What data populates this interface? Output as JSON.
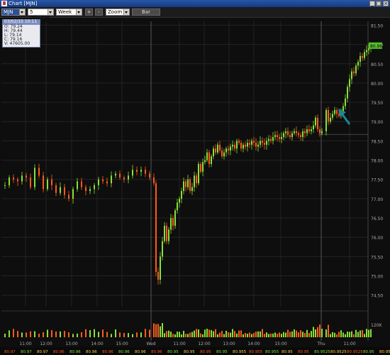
{
  "window": {
    "title": "Chart [MJN]",
    "buttons": [
      "_",
      "□",
      "×"
    ]
  },
  "toolbar": {
    "symbol": "MJN",
    "interval": "5 minutes",
    "range": "Week",
    "plus_label": "+",
    "minus_label": "-",
    "zoom": "Zoom",
    "bar_label": "Bar"
  },
  "ohlc_box": {
    "header": "03/02/15 10:11",
    "open": "O: 79.24",
    "high": "H: 79.44",
    "low": "L: 79.14",
    "close": "C: 79.16",
    "volume": "V: 47605.00"
  },
  "colors": {
    "up": "#88e038",
    "down": "#ff5a1e",
    "grid": "#232323",
    "arrow": "#1a8a96",
    "last_price_bg": "#58c02a"
  },
  "last_price": "80.96",
  "volume_axis_label": "120K",
  "footer_values": [
    "80.97",
    "80.97",
    "80.97",
    "80.96",
    "80.96",
    "80.96",
    "80.96",
    "80.96",
    "80.96",
    "80.96",
    "80.95",
    "80.95",
    "80.95",
    "80.95",
    "80.955",
    "80.955",
    "80.955",
    "80.95",
    "80.95",
    "80.9525",
    "80.9525",
    "80.9525",
    "80.95",
    "80.95"
  ],
  "chart_data": {
    "type": "candlestick",
    "y_ticks": [
      "81.50",
      "81.00",
      "80.50",
      "80.00",
      "79.50",
      "79.00",
      "78.50",
      "78.00",
      "77.50",
      "77.00",
      "76.50",
      "76.00",
      "75.50",
      "75.00",
      "74.50"
    ],
    "ylim": [
      74.2,
      81.6
    ],
    "x_ticks": [
      "11:00",
      "12:00",
      "13:00",
      "14:00",
      "15:00",
      "Wed",
      "11:00",
      "12:00",
      "13:00",
      "14:00",
      "15:00",
      "Thu",
      "11:00"
    ],
    "session_dividers_at": [
      "Wed",
      "Thu"
    ],
    "ohlc_close_path": [
      [
        0,
        77.35
      ],
      [
        6,
        77.55
      ],
      [
        12,
        77.5
      ],
      [
        18,
        77.45
      ],
      [
        24,
        77.6
      ],
      [
        30,
        77.55
      ],
      [
        36,
        77.3
      ],
      [
        42,
        77.8
      ],
      [
        48,
        77.6
      ],
      [
        54,
        77.25
      ],
      [
        60,
        77.5
      ],
      [
        66,
        77.35
      ],
      [
        72,
        77.15
      ],
      [
        78,
        77.3
      ],
      [
        84,
        77.1
      ],
      [
        90,
        77.0
      ],
      [
        96,
        77.25
      ],
      [
        102,
        77.45
      ],
      [
        108,
        77.3
      ],
      [
        114,
        77.2
      ],
      [
        120,
        77.25
      ],
      [
        126,
        77.35
      ],
      [
        132,
        77.5
      ],
      [
        138,
        77.45
      ],
      [
        144,
        77.4
      ],
      [
        150,
        77.6
      ],
      [
        156,
        77.65
      ],
      [
        162,
        77.55
      ],
      [
        168,
        77.5
      ],
      [
        174,
        77.6
      ],
      [
        180,
        77.75
      ],
      [
        186,
        77.7
      ],
      [
        192,
        77.75
      ],
      [
        198,
        77.65
      ],
      [
        204,
        77.55
      ],
      [
        210,
        77.4
      ],
      [
        213,
        75.1
      ],
      [
        216,
        74.9
      ],
      [
        219,
        75.5
      ],
      [
        222,
        75.9
      ],
      [
        225,
        76.3
      ],
      [
        228,
        75.9
      ],
      [
        231,
        76.2
      ],
      [
        234,
        76.5
      ],
      [
        237,
        76.3
      ],
      [
        240,
        76.7
      ],
      [
        243,
        76.9
      ],
      [
        246,
        77.0
      ],
      [
        249,
        77.2
      ],
      [
        252,
        77.45
      ],
      [
        255,
        77.3
      ],
      [
        258,
        77.5
      ],
      [
        261,
        77.2
      ],
      [
        264,
        77.3
      ],
      [
        267,
        77.6
      ],
      [
        270,
        77.4
      ],
      [
        273,
        77.9
      ],
      [
        276,
        77.7
      ],
      [
        279,
        77.95
      ],
      [
        282,
        78.0
      ],
      [
        285,
        78.2
      ],
      [
        288,
        77.9
      ],
      [
        291,
        78.1
      ],
      [
        294,
        78.3
      ],
      [
        297,
        78.2
      ],
      [
        300,
        78.4
      ],
      [
        303,
        78.25
      ],
      [
        306,
        78.1
      ],
      [
        309,
        78.2
      ],
      [
        312,
        78.3
      ],
      [
        315,
        78.25
      ],
      [
        318,
        78.35
      ],
      [
        321,
        78.4
      ],
      [
        324,
        78.3
      ],
      [
        327,
        78.5
      ],
      [
        330,
        78.45
      ],
      [
        333,
        78.3
      ],
      [
        336,
        78.4
      ],
      [
        339,
        78.35
      ],
      [
        342,
        78.45
      ],
      [
        345,
        78.4
      ],
      [
        348,
        78.5
      ],
      [
        351,
        78.45
      ],
      [
        354,
        78.35
      ],
      [
        357,
        78.4
      ],
      [
        360,
        78.5
      ],
      [
        363,
        78.45
      ],
      [
        366,
        78.4
      ],
      [
        369,
        78.5
      ],
      [
        372,
        78.55
      ],
      [
        375,
        78.5
      ],
      [
        378,
        78.6
      ],
      [
        381,
        78.65
      ],
      [
        384,
        78.6
      ],
      [
        387,
        78.55
      ],
      [
        390,
        78.6
      ],
      [
        393,
        78.7
      ],
      [
        396,
        78.75
      ],
      [
        399,
        78.65
      ],
      [
        402,
        78.6
      ],
      [
        405,
        78.7
      ],
      [
        408,
        78.75
      ],
      [
        411,
        78.7
      ],
      [
        414,
        78.65
      ],
      [
        417,
        78.6
      ],
      [
        420,
        78.75
      ],
      [
        423,
        78.7
      ],
      [
        426,
        78.8
      ],
      [
        429,
        78.75
      ],
      [
        432,
        78.8
      ],
      [
        435,
        78.9
      ],
      [
        438,
        79.1
      ],
      [
        441,
        78.8
      ],
      [
        444,
        78.7
      ],
      [
        447,
        78.75
      ],
      [
        453,
        79.3
      ],
      [
        456,
        79.0
      ],
      [
        459,
        79.1
      ],
      [
        462,
        79.2
      ],
      [
        465,
        79.3
      ],
      [
        468,
        79.2
      ],
      [
        471,
        79.15
      ],
      [
        474,
        79.25
      ],
      [
        477,
        79.4
      ],
      [
        480,
        79.6
      ],
      [
        483,
        79.9
      ],
      [
        486,
        80.1
      ],
      [
        489,
        80.3
      ],
      [
        492,
        80.25
      ],
      [
        495,
        80.45
      ],
      [
        498,
        80.55
      ],
      [
        501,
        80.7
      ],
      [
        504,
        80.65
      ],
      [
        507,
        80.8
      ],
      [
        510,
        80.85
      ],
      [
        513,
        80.9
      ],
      [
        516,
        80.96
      ]
    ]
  }
}
